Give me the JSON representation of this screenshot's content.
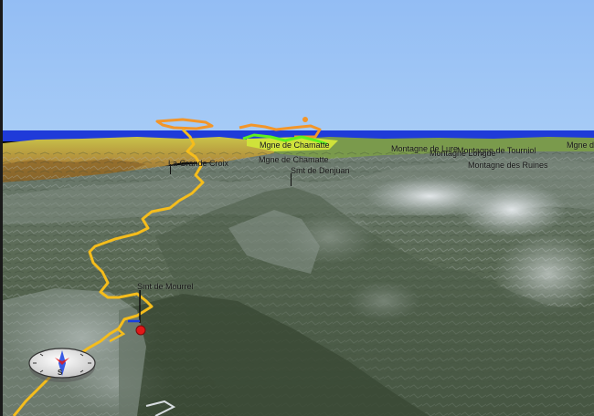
{
  "colors": {
    "sky": "#9cc3f5",
    "sea": "#1f3bd9",
    "track": "#f5bd1c",
    "track_far": "#f2962a",
    "track_top": "#5ef01e",
    "marker_red": "#e01818",
    "marker_blue": "#1840e0"
  },
  "labels": [
    {
      "text": "Mgne de Chamatte",
      "id": "label-mgne-de-chamatte"
    },
    {
      "text": "Mgne de Chamatte",
      "id": "label-mgne-de-chamatte-2"
    },
    {
      "text": "La Grande Croix",
      "id": "label-la-grande-croix"
    },
    {
      "text": "Smt de Denjuan",
      "id": "label-smt-de-denjuan"
    },
    {
      "text": "Smt de Mourrel",
      "id": "label-smt-de-mourrel"
    },
    {
      "text": "Montagne de Lure",
      "id": "label-montagne-de-lure"
    },
    {
      "text": "Montagne Longue",
      "id": "label-montagne-longue"
    },
    {
      "text": "Montagne de Tourniol",
      "id": "label-montagne-de-tourniol"
    },
    {
      "text": "Montagne des Ruines",
      "id": "label-montagne-des-ruines"
    },
    {
      "text": "Mgne de Chamatte",
      "id": "label-far-right"
    }
  ],
  "compass": {
    "icon": "compass-rose-icon",
    "letter": "S"
  }
}
